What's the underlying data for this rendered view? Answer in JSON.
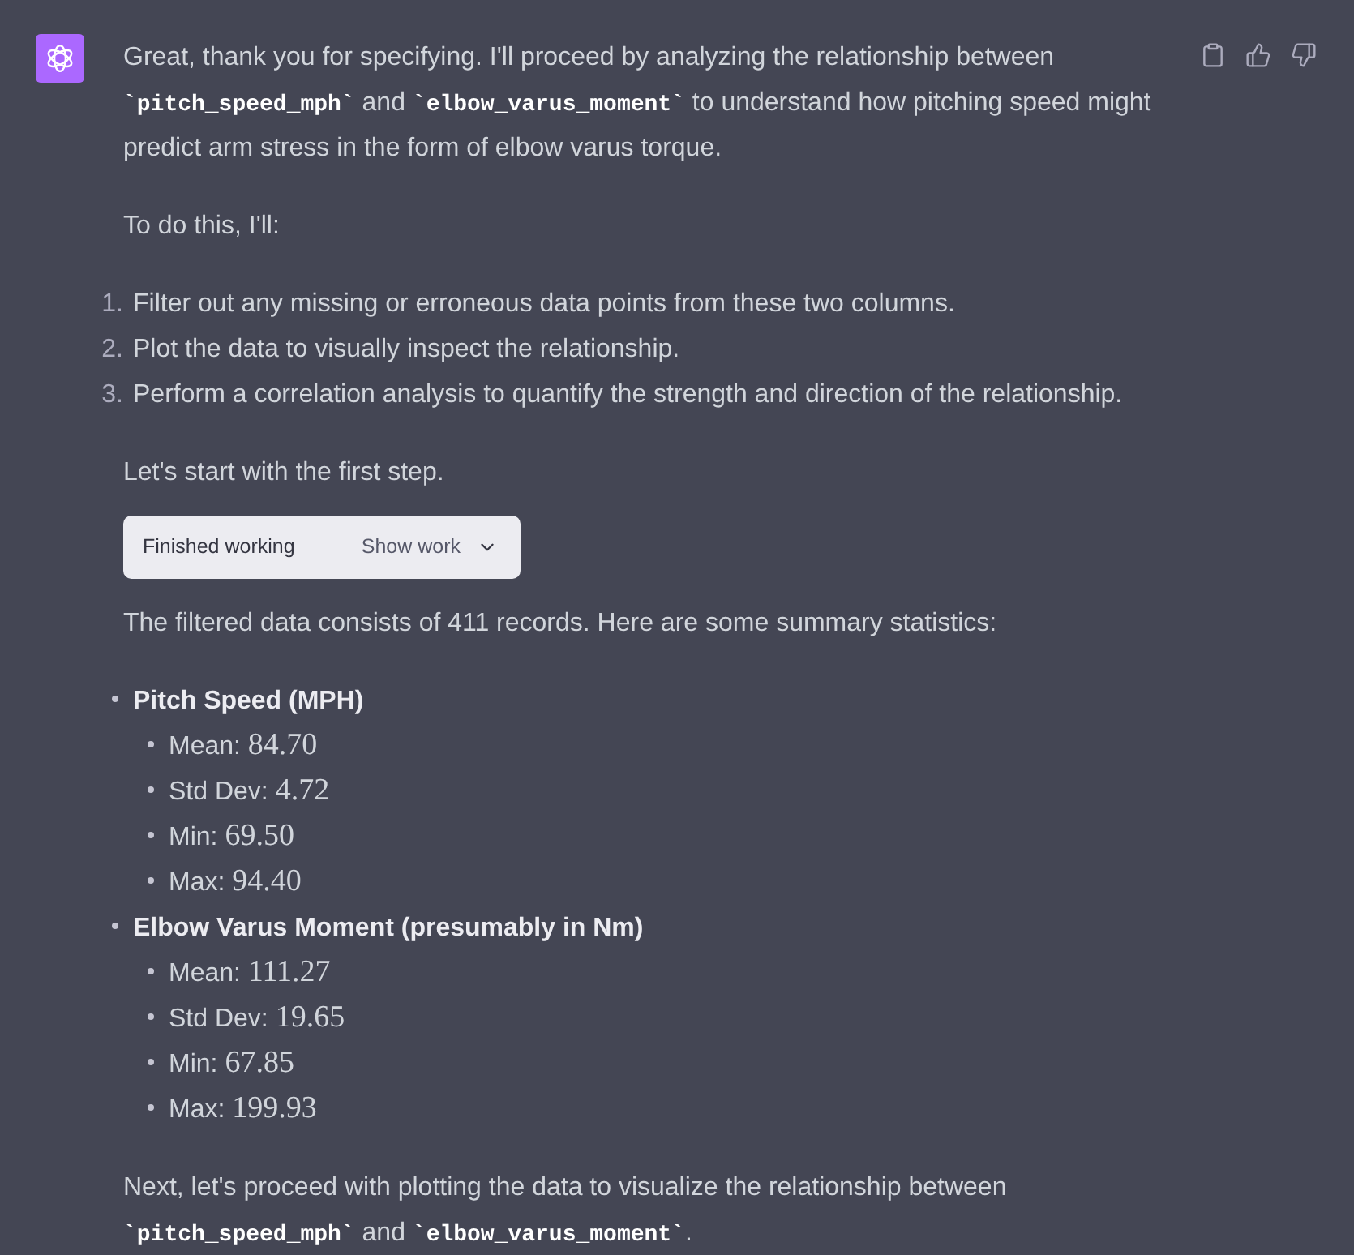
{
  "blocks": [
    {
      "kind": "paragraph",
      "segments": [
        {
          "kind": "text",
          "text": "Great, thank you for specifying. I'll proceed by analyzing the relationship between "
        },
        {
          "kind": "code",
          "text": "`pitch_speed_mph`"
        },
        {
          "kind": "text",
          "text": " and "
        },
        {
          "kind": "code",
          "text": "`elbow_varus_moment`"
        },
        {
          "kind": "text",
          "text": " to understand how pitching speed might predict arm stress in the form of elbow varus torque."
        }
      ]
    },
    {
      "kind": "paragraph",
      "segments": [
        {
          "kind": "text",
          "text": "To do this, I'll:"
        }
      ]
    },
    {
      "kind": "numbered_list",
      "items": [
        {
          "number": "1.",
          "text": "Filter out any missing or erroneous data points from these two columns."
        },
        {
          "number": "2.",
          "text": "Plot the data to visually inspect the relationship."
        },
        {
          "number": "3.",
          "text": "Perform a correlation analysis to quantify the strength and direction of the relationship."
        }
      ]
    },
    {
      "kind": "paragraph",
      "segments": [
        {
          "kind": "text",
          "text": "Let's start with the first step."
        }
      ]
    },
    {
      "kind": "status",
      "label": "Finished working",
      "button": "Show work",
      "expanded": false
    },
    {
      "kind": "paragraph",
      "segments": [
        {
          "kind": "text",
          "text": "The filtered data consists of 411 records. Here are some summary statistics:"
        }
      ]
    },
    {
      "kind": "bullet_list",
      "items": [
        {
          "text": "Pitch Speed (MPH)",
          "children": [
            {
              "label": "Mean:",
              "value": "84.70"
            },
            {
              "label": "Std Dev:",
              "value": "4.72"
            },
            {
              "label": "Min:",
              "value": "69.50"
            },
            {
              "label": "Max:",
              "value": "94.40"
            }
          ]
        },
        {
          "text": "Elbow Varus Moment (presumably in Nm)",
          "children": [
            {
              "label": "Mean:",
              "value": "111.27"
            },
            {
              "label": "Std Dev:",
              "value": "19.65"
            },
            {
              "label": "Min:",
              "value": "67.85"
            },
            {
              "label": "Max:",
              "value": "199.93"
            }
          ]
        }
      ]
    },
    {
      "kind": "paragraph",
      "segments": [
        {
          "kind": "text",
          "text": "Next, let's proceed with plotting the data to visualize the relationship between "
        },
        {
          "kind": "code",
          "text": "`pitch_speed_mph`"
        },
        {
          "kind": "text",
          "text": " and "
        },
        {
          "kind": "code",
          "text": "`elbow_varus_moment`"
        },
        {
          "kind": "text",
          "text": "."
        }
      ]
    }
  ]
}
